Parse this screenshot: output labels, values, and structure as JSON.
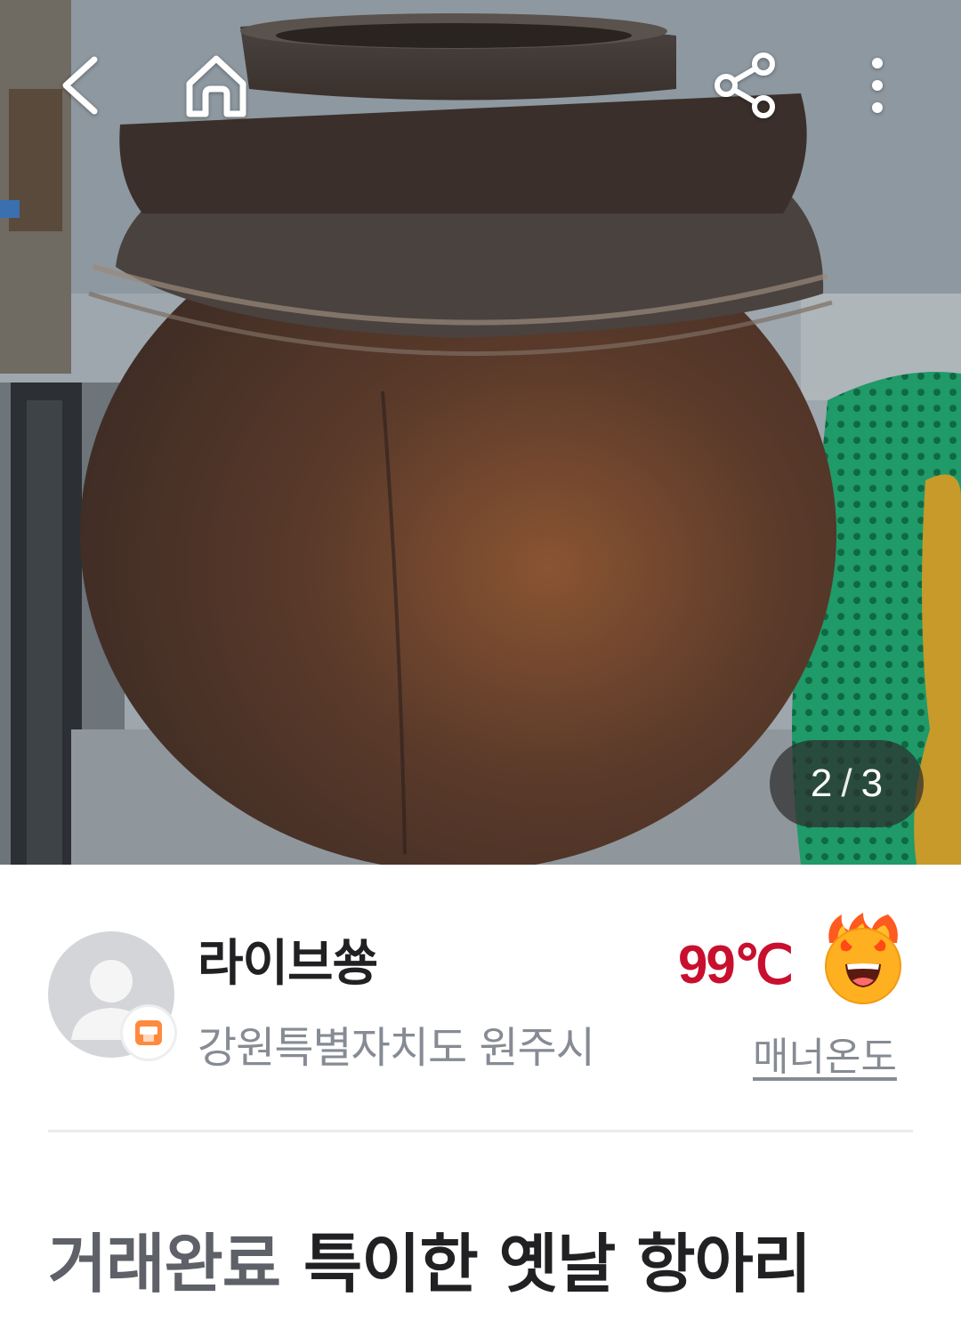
{
  "header": {
    "back_icon": "chevron-left-icon",
    "home_icon": "home-icon",
    "share_icon": "share-icon",
    "more_icon": "more-vertical-icon"
  },
  "gallery": {
    "current": "2",
    "separator": "/",
    "total": "3"
  },
  "seller": {
    "nickname": "라이브쑝",
    "region": "강원특별자치도 원주시",
    "manner_temperature": "99℃",
    "manner_label": "매너온도",
    "temperature_color": "#c8102e"
  },
  "article": {
    "status": "거래완료",
    "title": "특이한 옛날 항아리"
  }
}
